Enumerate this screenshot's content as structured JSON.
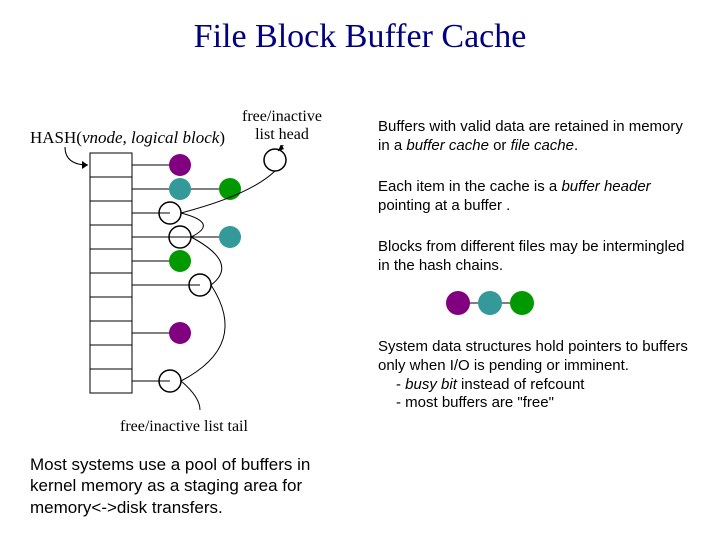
{
  "title": "File Block Buffer Cache",
  "labels": {
    "hash": "HASH(",
    "hash_args": "vnode, logical block",
    "hash_close": ")",
    "free_head_l1": "free/inactive",
    "free_head_l2": "list head",
    "free_tail": "free/inactive list tail"
  },
  "paras": {
    "p1a": "Buffers with valid data are retained in memory in a ",
    "p1b": "buffer cache",
    "p1c": " or ",
    "p1d": "file cache",
    "p1e": ".",
    "p2a": "Each item in the cache is a ",
    "p2b": "buffer header",
    "p2c": " pointing at a buffer .",
    "p3": "Blocks from different files may be intermingled in the hash chains.",
    "p4": "System data structures hold pointers to buffers only when I/O is pending or imminent.",
    "p4b1a": "- ",
    "p4b1b": "busy bit",
    "p4b1c": " instead of refcount",
    "p4b2": "- most buffers are \"free\"",
    "bottom": "Most systems use a pool of buffers in kernel memory as a staging area for memory<->disk transfers."
  },
  "colors": {
    "purple": "#800080",
    "teal": "#339999",
    "green": "#009900"
  }
}
